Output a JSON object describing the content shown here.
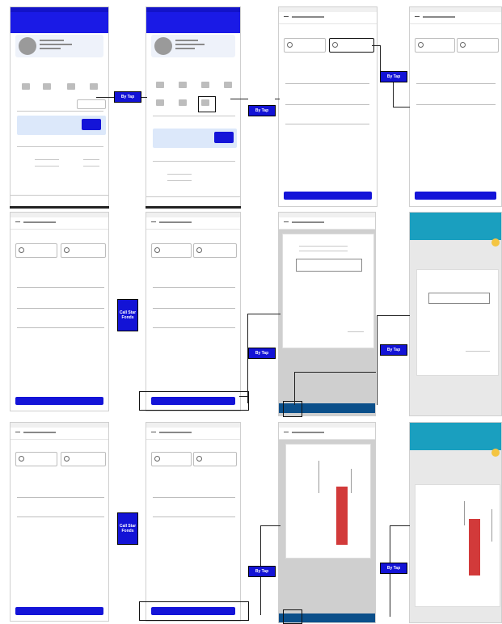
{
  "callouts": {
    "tap1": "By Tap",
    "tap2": "By Tap",
    "tap3": "By Tap",
    "tap4": "By Tap",
    "tap5": "By Tap",
    "tap6": "By Tap",
    "tap7": "By Tap",
    "swipe1": "Call Star Fonds",
    "swipe2": "Call Star Fonds"
  },
  "colors": {
    "primary_blue": "#1414d8",
    "teal": "#1a9fbf",
    "red_stamp": "#d23a3a",
    "accent_yellow": "#f4c542"
  },
  "icons": [
    "back-arrow-icon",
    "avatar-icon",
    "menu-grid-icon",
    "radio-icon",
    "chevron-down-icon"
  ]
}
